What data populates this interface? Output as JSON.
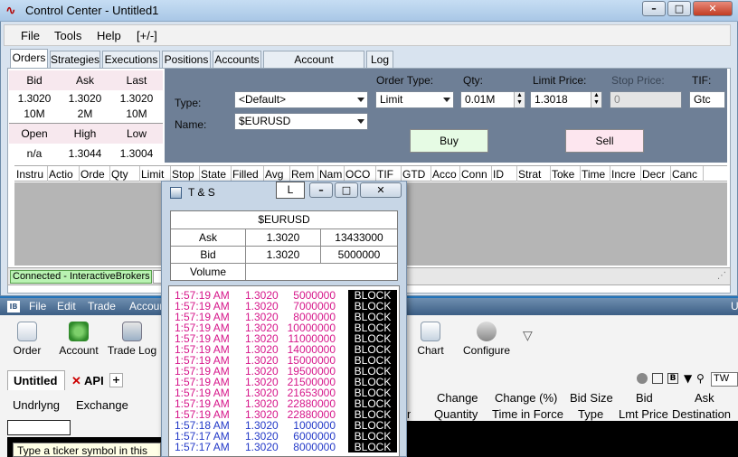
{
  "control_center": {
    "title": "Control Center - Untitled1",
    "menu": [
      "File",
      "Tools",
      "Help",
      "[+/-]"
    ],
    "tabs": [
      "Orders",
      "Strategies",
      "Executions",
      "Positions",
      "Accounts",
      "Account Performance",
      "Log"
    ],
    "quote": {
      "headers1": [
        "Bid",
        "Ask",
        "Last"
      ],
      "values1": [
        "1.3020",
        "1.3020",
        "1.3020"
      ],
      "sizes1": [
        "10M",
        "2M",
        "10M"
      ],
      "headers2": [
        "Open",
        "High",
        "Low"
      ],
      "values2": [
        "n/a",
        "1.3044",
        "1.3004"
      ]
    },
    "entry": {
      "type_label": "Type:",
      "type_value": "<Default>",
      "name_label": "Name:",
      "name_value": "$EURUSD",
      "order_type_label": "Order Type:",
      "order_type_value": "Limit",
      "qty_label": "Qty:",
      "qty_value": "0.01M",
      "limit_label": "Limit Price:",
      "limit_value": "1.3018",
      "stop_label": "Stop Price:",
      "stop_value": "0",
      "tif_label": "TIF:",
      "tif_value": "Gtc",
      "buy": "Buy",
      "sell": "Sell"
    },
    "grid_columns": [
      "Instru",
      "Actio",
      "Orde",
      "Qty",
      "Limit",
      "Stop",
      "State",
      "Filled",
      "Avg",
      "Rem",
      "Nam",
      "OCO",
      "TIF",
      "GTD",
      "Acco",
      "Conn",
      "ID",
      "Strat",
      "Toke",
      "Time",
      "Incre",
      "Decr",
      "Canc"
    ],
    "status": "Connected - InteractiveBrokers"
  },
  "ib": {
    "menu": [
      "File",
      "Edit",
      "Trade",
      "Accour"
    ],
    "tools": [
      "Order",
      "Account",
      "Trade Log"
    ],
    "tools_right": [
      "Chart",
      "Configure"
    ],
    "tabs": [
      "Untitled",
      "API",
      "+"
    ],
    "sub_headers": [
      "Undrlyng",
      "Exchange"
    ],
    "tooltip": "Type a ticker symbol in this",
    "cols_top": [
      "Change",
      "Change (%)",
      "Bid Size",
      "Bid",
      "Ask"
    ],
    "cols_bottom": [
      "Quantity",
      "Time in Force",
      "Type",
      "Lmt Price",
      "Destination"
    ],
    "search_hint": "TW"
  },
  "ts": {
    "title": "T & S",
    "lock_label": "L",
    "symbol": "$EURUSD",
    "ask_label": "Ask",
    "ask_price": "1.3020",
    "ask_size": "13433000",
    "bid_label": "Bid",
    "bid_price": "1.3020",
    "bid_size": "5000000",
    "volume_label": "Volume",
    "trades": [
      {
        "t": "1:57:19 AM",
        "p": "1.3020",
        "s": "5000000",
        "x": "BLOCK",
        "c": "pink"
      },
      {
        "t": "1:57:19 AM",
        "p": "1.3020",
        "s": "7000000",
        "x": "BLOCK",
        "c": "pink"
      },
      {
        "t": "1:57:19 AM",
        "p": "1.3020",
        "s": "8000000",
        "x": "BLOCK",
        "c": "pink"
      },
      {
        "t": "1:57:19 AM",
        "p": "1.3020",
        "s": "10000000",
        "x": "BLOCK",
        "c": "pink"
      },
      {
        "t": "1:57:19 AM",
        "p": "1.3020",
        "s": "11000000",
        "x": "BLOCK",
        "c": "pink"
      },
      {
        "t": "1:57:19 AM",
        "p": "1.3020",
        "s": "14000000",
        "x": "BLOCK",
        "c": "pink"
      },
      {
        "t": "1:57:19 AM",
        "p": "1.3020",
        "s": "15000000",
        "x": "BLOCK",
        "c": "pink"
      },
      {
        "t": "1:57:19 AM",
        "p": "1.3020",
        "s": "19500000",
        "x": "BLOCK",
        "c": "pink"
      },
      {
        "t": "1:57:19 AM",
        "p": "1.3020",
        "s": "21500000",
        "x": "BLOCK",
        "c": "pink"
      },
      {
        "t": "1:57:19 AM",
        "p": "1.3020",
        "s": "21653000",
        "x": "BLOCK",
        "c": "pink"
      },
      {
        "t": "1:57:19 AM",
        "p": "1.3020",
        "s": "22880000",
        "x": "BLOCK",
        "c": "pink"
      },
      {
        "t": "1:57:19 AM",
        "p": "1.3020",
        "s": "22880000",
        "x": "BLOCK",
        "c": "pink"
      },
      {
        "t": "1:57:18 AM",
        "p": "1.3020",
        "s": "1000000",
        "x": "BLOCK",
        "c": "blue"
      },
      {
        "t": "1:57:17 AM",
        "p": "1.3020",
        "s": "6000000",
        "x": "BLOCK",
        "c": "blue"
      },
      {
        "t": "1:57:17 AM",
        "p": "1.3020",
        "s": "8000000",
        "x": "BLOCK",
        "c": "blue"
      }
    ]
  },
  "colors": {
    "pink": "#d6168a",
    "blue": "#2339c8",
    "entry_bg": "#6e7f96",
    "connected_bg": "#b9f3b2"
  }
}
